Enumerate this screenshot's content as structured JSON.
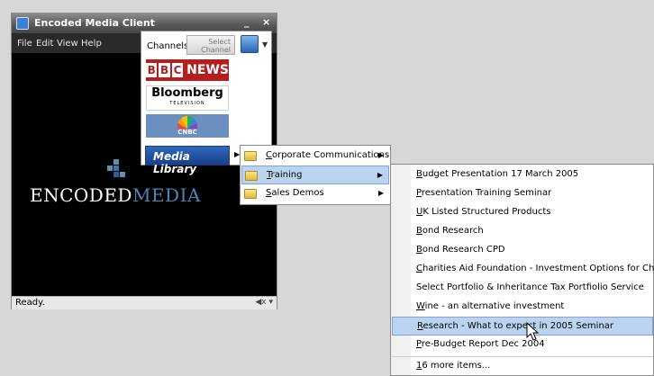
{
  "window": {
    "title": "Encoded Media Client",
    "minimize": "_",
    "close": "×",
    "menu": [
      "File",
      "Edit",
      "View",
      "Help"
    ]
  },
  "video": {
    "logo_text_1": "ENCODED",
    "logo_text_2": "MEDIA"
  },
  "status": {
    "text": "Ready.",
    "speaker": "◀x ▾"
  },
  "channels": {
    "label": "Channels",
    "select_line1": "Select",
    "select_line2": "Channel",
    "logos": [
      {
        "name": "bbc-news-logo",
        "letters": [
          "B",
          "B",
          "C"
        ],
        "text": "NEWS"
      },
      {
        "name": "bloomberg-logo",
        "text": "Bloomberg",
        "sub": "TELEVISION"
      },
      {
        "name": "cnbc-logo",
        "text": "CNBC"
      }
    ],
    "media_library": "Media Library"
  },
  "menu1": [
    {
      "label": "Corporate Communications",
      "accel": "C",
      "rest": "orporate Communications"
    },
    {
      "label": "Training",
      "accel": "T",
      "rest": "raining",
      "highlighted": true
    },
    {
      "label": "Sales Demos",
      "accel": "S",
      "rest": "ales Demos"
    }
  ],
  "menu2": [
    {
      "label": "Budget Presentation 17 March 2005",
      "accel": "B",
      "rest": "udget Presentation 17 March 2005"
    },
    {
      "label": "Presentation Training Seminar",
      "accel": "P",
      "rest": "resentation Training Seminar"
    },
    {
      "label": "UK Listed Structured Products",
      "accel": "U",
      "rest": "K Listed Structured Products"
    },
    {
      "label": "Bond Research",
      "accel": "B",
      "rest": "ond Research"
    },
    {
      "label": "Bond Research CPD",
      "accel": "B",
      "rest": "ond Research CPD"
    },
    {
      "label": "Charities Aid Foundation - Investment Options for Charities",
      "accel": "C",
      "rest": "harities Aid Foundation - Investment Options for Charities"
    },
    {
      "label": "Select Portfolio & Inheritance Tax Portfiolio Service",
      "accel": "",
      "rest": "Select Portfolio & Inheritance Tax Portfiolio Service"
    },
    {
      "label": "Wine - an alternative investment",
      "accel": "W",
      "rest": "ine - an alternative investment"
    },
    {
      "label": "Research - What to expect in 2005 Seminar",
      "accel": "R",
      "rest": "esearch - What to expect in 2005 Seminar",
      "highlighted": true
    },
    {
      "label": "Pre-Budget Report Dec 2004",
      "accel": "P",
      "rest": "re-Budget Report Dec 2004"
    },
    {
      "label": "16 more items...",
      "accel": "1",
      "rest": "6 more items..."
    }
  ],
  "colors": {
    "highlight": "#bcd3ef",
    "media_library": "#1b3f86",
    "logo_blue": "#4f84b8"
  }
}
